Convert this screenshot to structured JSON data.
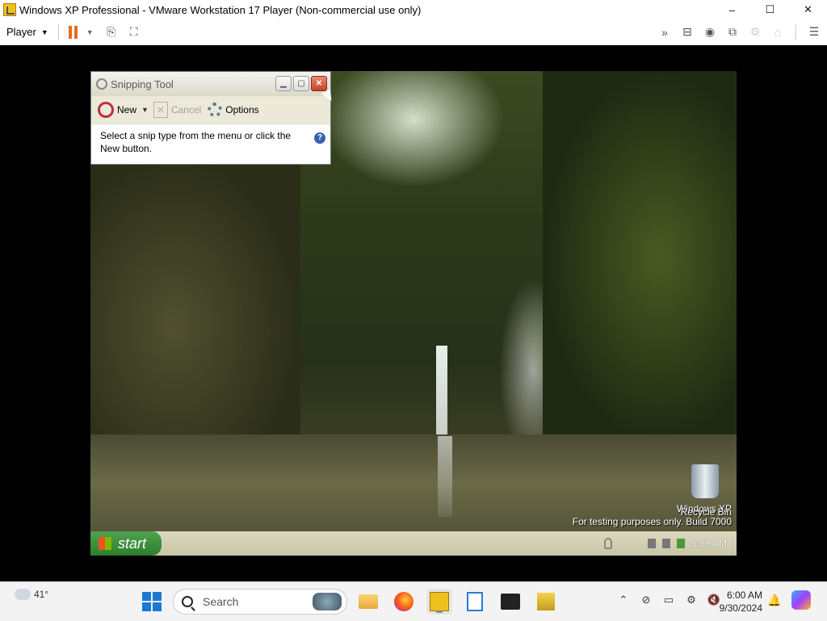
{
  "vmware": {
    "title": "Windows XP Professional - VMware Workstation 17 Player (Non-commercial use only)",
    "controls": {
      "minimize": "–",
      "maximize": "☐",
      "close": "✕"
    },
    "menu": {
      "player": "Player"
    },
    "toolbar_icons": [
      "pause-icon",
      "send-ctrl-alt-del-icon",
      "fullscreen-icon",
      "forward-icon",
      "removable-devices-icon",
      "network-icon",
      "usb-icon",
      "message-log-icon"
    ]
  },
  "snipping_tool": {
    "title": "Snipping Tool",
    "buttons": {
      "new": "New",
      "cancel": "Cancel",
      "options": "Options"
    },
    "message": "Select a snip type from the menu or click the New button."
  },
  "desktop": {
    "recycle_bin": "Recycle Bin",
    "watermark_line1": "Windows XP",
    "watermark_line2": "For testing purposes only. Build 7000"
  },
  "xp_taskbar": {
    "start": "start",
    "clock": "5:59 AM"
  },
  "win11_taskbar": {
    "weather_temp": "41°",
    "search_placeholder": "Search",
    "time": "6:00 AM",
    "date": "9/30/2024",
    "pinned_apps": [
      "File Explorer",
      "Firefox",
      "VMware Workstation",
      "Notepad",
      "Terminal",
      "Package"
    ]
  }
}
